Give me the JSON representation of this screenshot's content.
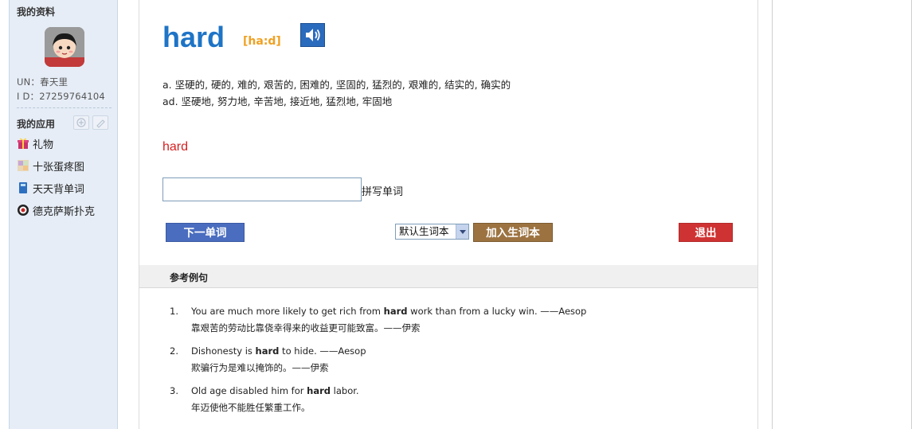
{
  "sidebar": {
    "profile_title": "我的资料",
    "un_line": "UN：春天里",
    "id_line": "I D：27259764104",
    "apps_title": "我的应用",
    "apps": [
      {
        "label": "礼物",
        "icon": "gift-icon"
      },
      {
        "label": "十张蛋疼图",
        "icon": "picture-icon"
      },
      {
        "label": "天天背单词",
        "icon": "book-icon"
      },
      {
        "label": "德克萨斯扑克",
        "icon": "poker-chip-icon"
      }
    ]
  },
  "word": {
    "text": "hard",
    "phonetic": "[ha:d]",
    "def_a": "a. 坚硬的, 硬的, 难的, 艰苦的, 困难的, 坚固的, 猛烈的, 艰难的, 结实的, 确实的",
    "def_ad": "ad. 坚硬地, 努力地, 辛苦地, 接近地, 猛烈地, 牢固地",
    "quiz_word": "hard"
  },
  "spell": {
    "value": "",
    "label": "拼写单词"
  },
  "controls": {
    "next_label": "下一单词",
    "notebook_selected": "默认生词本",
    "add_label": "加入生词本",
    "exit_label": "退出"
  },
  "examples": {
    "title": "参考例句",
    "items": [
      {
        "num": "1.",
        "pre": "You are much more likely to get rich from ",
        "bold": "hard",
        "post": " work than from a lucky win. ——Aesop",
        "zh": "靠艰苦的劳动比靠侥幸得来的收益更可能致富。——伊索"
      },
      {
        "num": "2.",
        "pre": "Dishonesty is ",
        "bold": "hard",
        "post": " to hide. ——Aesop",
        "zh": "欺骗行为是难以掩饰的。——伊索"
      },
      {
        "num": "3.",
        "pre": "Old age disabled him for ",
        "bold": "hard",
        "post": " labor.",
        "zh": "年迈使他不能胜任繁重工作。"
      }
    ]
  },
  "colors": {
    "word": "#1e74c6",
    "phonetic": "#f0a020",
    "quiz": "#d62020",
    "next_btn": "#4a6dbf",
    "add_btn": "#9c7340",
    "exit_btn": "#cf3232",
    "sidebar_bg": "#e6edf6"
  }
}
